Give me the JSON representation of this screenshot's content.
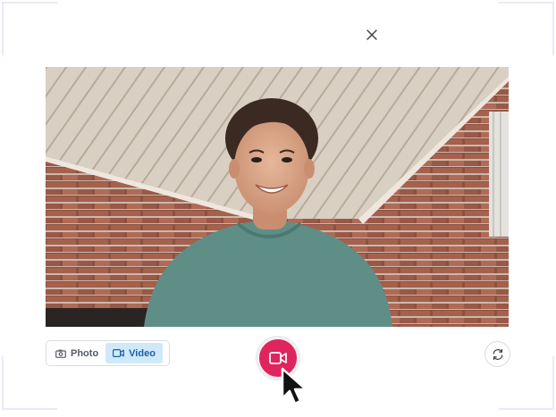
{
  "dialog": {
    "close_icon": "close-icon"
  },
  "preview": {
    "description_icon": "camera-feed"
  },
  "mode_toggle": {
    "photo_label": "Photo",
    "video_label": "Video",
    "active": "Video",
    "photo_icon": "camera-icon",
    "video_icon": "video-camera-icon"
  },
  "controls": {
    "record_icon": "video-camera-icon",
    "flip_icon": "refresh-icon"
  },
  "colors": {
    "record": "#e0245e",
    "active_mode_bg": "#cfe9f9",
    "active_mode_text": "#1d5fa8"
  }
}
